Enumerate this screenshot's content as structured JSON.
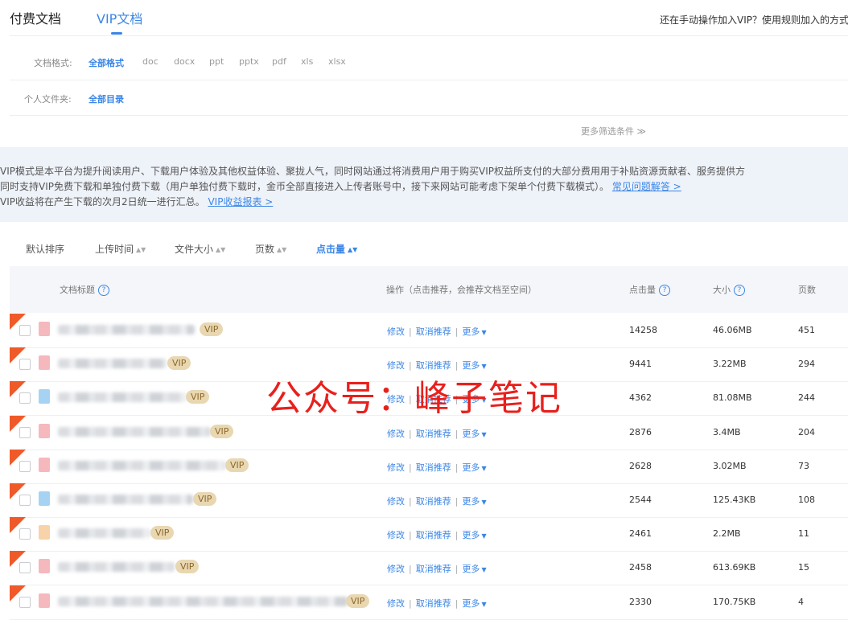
{
  "tabs": {
    "paid": "付费文档",
    "vip": "VIP文档"
  },
  "top_hint": "还在手动操作加入VIP？使用规则加入的方式",
  "filters": {
    "format_label": "文档格式:",
    "formats": [
      "全部格式",
      "doc",
      "docx",
      "ppt",
      "pptx",
      "pdf",
      "xls",
      "xlsx"
    ],
    "folder_label": "个人文件夹:",
    "folders": [
      "全部目录"
    ],
    "more": "更多筛选条件 ≫"
  },
  "notice": {
    "line1": "VIP模式是本平台为提升阅读用户、下载用户体验及其他权益体验、聚拢人气，同时网站通过将消费用户用于购买VIP权益所支付的大部分费用用于补贴资源贡献者、服务提供方",
    "line2": "同时支持VIP免费下载和单独付费下载（用户单独付费下载时，金币全部直接进入上传者账号中，接下来网站可能考虑下架单个付费下载模式）。",
    "line2_link": "常见问题解答 >",
    "line3": "VIP收益将在产生下载的次月2日统一进行汇总。",
    "line3_link": "VIP收益报表 >"
  },
  "sort_bar": {
    "items": [
      "默认排序",
      "上传时间",
      "文件大小",
      "页数",
      "点击量"
    ],
    "active": "点击量"
  },
  "table": {
    "headers": {
      "title": "文档标题",
      "ops": "操作（点击推荐，会推荐文档至空间）",
      "clicks": "点击量",
      "size": "大小",
      "pages": "页数"
    },
    "vip_badge": "VIP",
    "op_labels": {
      "edit": "修改",
      "unrecommend": "取消推荐",
      "more": "更多"
    },
    "rows": [
      {
        "clicks": "14258",
        "size": "46.06MB",
        "pages": "451",
        "icon_color": "#f5b8bd"
      },
      {
        "clicks": "9441",
        "size": "3.22MB",
        "pages": "294",
        "icon_color": "#f5b8bd"
      },
      {
        "clicks": "4362",
        "size": "81.08MB",
        "pages": "244",
        "icon_color": "#a7d3f2"
      },
      {
        "clicks": "2876",
        "size": "3.4MB",
        "pages": "204",
        "icon_color": "#f5b8bd"
      },
      {
        "clicks": "2628",
        "size": "3.02MB",
        "pages": "73",
        "icon_color": "#f5b8bd"
      },
      {
        "clicks": "2544",
        "size": "125.43KB",
        "pages": "108",
        "icon_color": "#a7d3f2"
      },
      {
        "clicks": "2461",
        "size": "2.2MB",
        "pages": "11",
        "icon_color": "#f8d2a8"
      },
      {
        "clicks": "2458",
        "size": "613.69KB",
        "pages": "15",
        "icon_color": "#f5b8bd"
      },
      {
        "clicks": "2330",
        "size": "170.75KB",
        "pages": "4",
        "icon_color": "#f5b8bd"
      }
    ]
  },
  "watermark": "公众号：峰子笔记",
  "colors": {
    "accent": "#3b86e6",
    "corner": "#f05a28",
    "vip_badge": "#e9d7b2",
    "watermark": "#e8201c"
  }
}
